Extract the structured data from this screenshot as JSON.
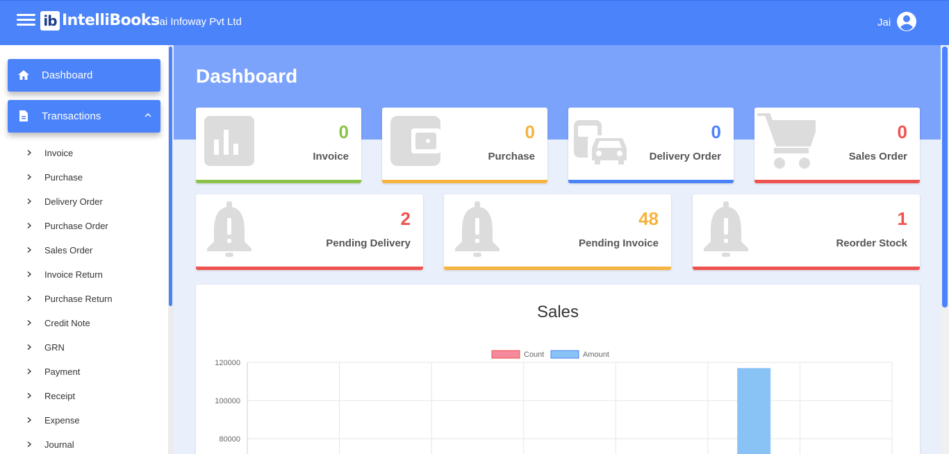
{
  "header": {
    "logo_mark": "ib",
    "app_name": "IntelliBooks",
    "company": "Jai Infoway Pvt Ltd",
    "user": "Jai"
  },
  "sidebar": {
    "dashboard_label": "Dashboard",
    "transactions_label": "Transactions",
    "items": [
      {
        "label": "Invoice"
      },
      {
        "label": "Purchase"
      },
      {
        "label": "Delivery Order"
      },
      {
        "label": "Purchase Order"
      },
      {
        "label": "Sales Order"
      },
      {
        "label": "Invoice Return"
      },
      {
        "label": "Purchase Return"
      },
      {
        "label": "Credit Note"
      },
      {
        "label": "GRN"
      },
      {
        "label": "Payment"
      },
      {
        "label": "Receipt"
      },
      {
        "label": "Expense"
      },
      {
        "label": "Journal"
      }
    ]
  },
  "page": {
    "title": "Dashboard"
  },
  "stats_top": [
    {
      "value": "0",
      "label": "Invoice",
      "color": "#8bc34a",
      "icon": "bar-chart-icon"
    },
    {
      "value": "0",
      "label": "Purchase",
      "color": "#f6b340",
      "icon": "wallet-icon"
    },
    {
      "value": "0",
      "label": "Delivery Order",
      "color": "#4b83fb",
      "icon": "transport-icon"
    },
    {
      "value": "0",
      "label": "Sales Order",
      "color": "#ef5350",
      "icon": "cart-icon"
    }
  ],
  "stats_bottom": [
    {
      "value": "2",
      "label": "Pending Delivery",
      "color": "#ef5350",
      "icon": "bell-alert-icon"
    },
    {
      "value": "48",
      "label": "Pending Invoice",
      "color": "#f6b340",
      "icon": "bell-alert-icon"
    },
    {
      "value": "1",
      "label": "Reorder Stock",
      "color": "#ef5350",
      "icon": "bell-alert-icon"
    }
  ],
  "chart_data": {
    "type": "bar",
    "title": "Sales",
    "legend_position": "top",
    "series": [
      {
        "name": "Count",
        "color": "#f48a9b",
        "values": [
          0,
          0,
          0,
          0,
          0,
          0,
          0
        ]
      },
      {
        "name": "Amount",
        "color": "#89c2f5",
        "values": [
          0,
          0,
          0,
          0,
          0,
          117000,
          0
        ]
      }
    ],
    "y_ticks": [
      "120000",
      "100000",
      "80000"
    ],
    "ylim_visible": [
      80000,
      120000
    ],
    "grid": true
  }
}
